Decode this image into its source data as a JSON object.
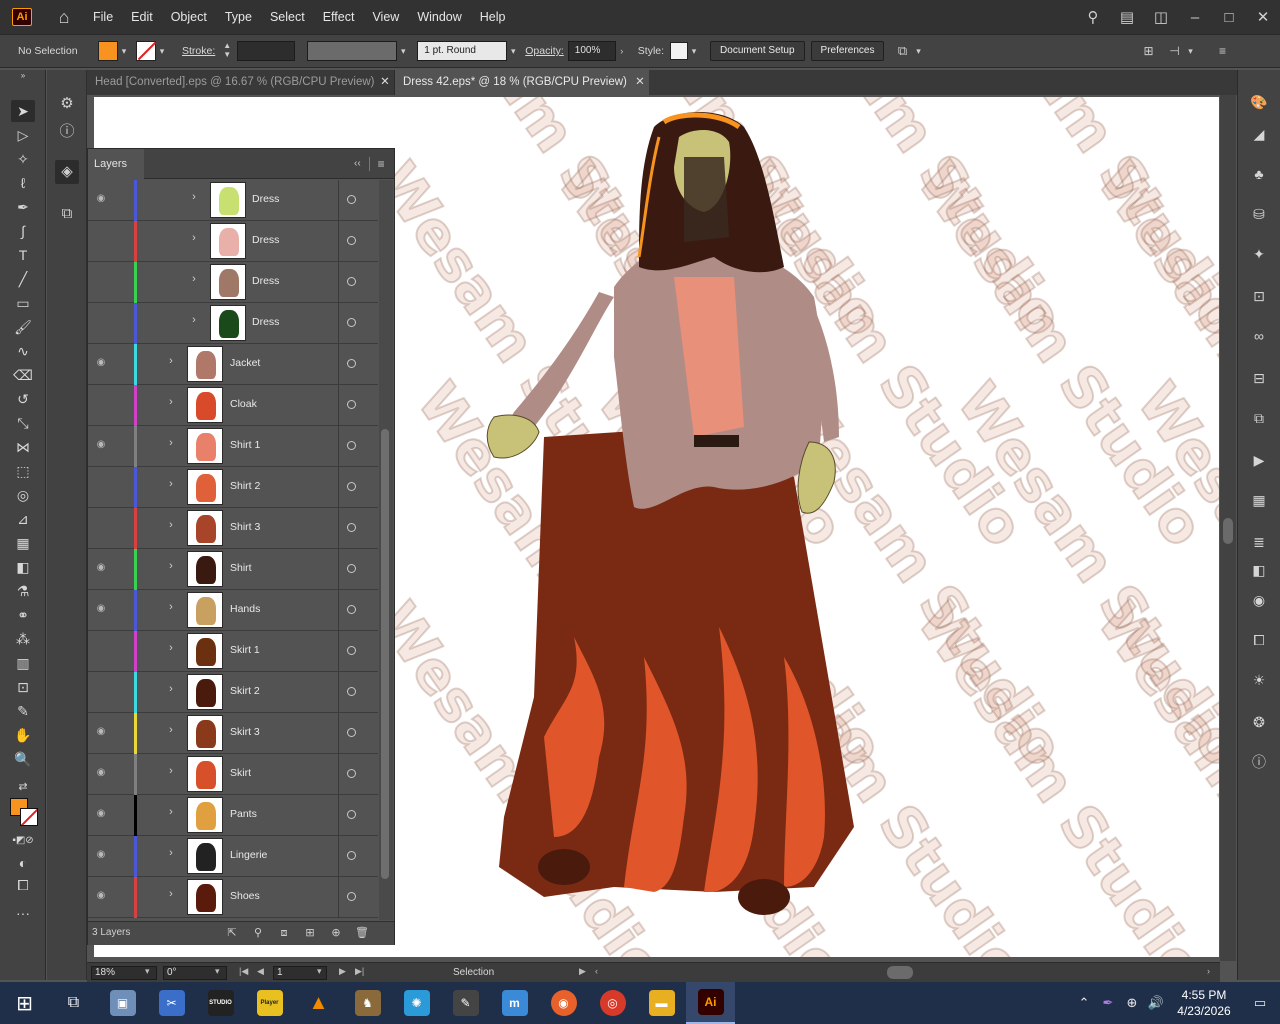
{
  "app": {
    "logo": "Ai",
    "home_icon": "home-icon"
  },
  "menu": [
    "File",
    "Edit",
    "Object",
    "Type",
    "Select",
    "Effect",
    "View",
    "Window",
    "Help"
  ],
  "control": {
    "selection_label": "No Selection",
    "fill_color": "#f7931e",
    "stroke_label": "Stroke:",
    "stroke_profile": "1 pt. Round",
    "opacity_label": "Opacity:",
    "opacity_value": "100%",
    "style_label": "Style:",
    "document_setup": "Document Setup",
    "preferences": "Preferences"
  },
  "tabs": [
    {
      "label": "Head [Converted].eps @ 16.67 % (RGB/CPU Preview)",
      "active": false
    },
    {
      "label": "Dress 42.eps* @ 18 % (RGB/CPU Preview)",
      "active": true
    }
  ],
  "layers": {
    "title": "Layers",
    "count_label": "3 Layers",
    "rows": [
      {
        "name": "Dress",
        "visible": true,
        "color": "#4a57d6",
        "sub": true
      },
      {
        "name": "Dress",
        "visible": false,
        "color": "#d94040",
        "sub": true
      },
      {
        "name": "Dress",
        "visible": false,
        "color": "#3ad052",
        "sub": true
      },
      {
        "name": "Dress",
        "visible": false,
        "color": "#4a57d6",
        "sub": true
      },
      {
        "name": "Jacket",
        "visible": true,
        "color": "#3fd7e0",
        "sub": false
      },
      {
        "name": "Cloak",
        "visible": false,
        "color": "#d040c8",
        "sub": false
      },
      {
        "name": "Shirt 1",
        "visible": true,
        "color": "#808080",
        "sub": false
      },
      {
        "name": "Shirt 2",
        "visible": false,
        "color": "#4a57d6",
        "sub": false
      },
      {
        "name": "Shirt 3",
        "visible": false,
        "color": "#d94040",
        "sub": false
      },
      {
        "name": "Shirt",
        "visible": true,
        "color": "#3ad052",
        "sub": false
      },
      {
        "name": "Hands",
        "visible": true,
        "color": "#4a57d6",
        "sub": false
      },
      {
        "name": "Skirt 1",
        "visible": false,
        "color": "#d040c8",
        "sub": false
      },
      {
        "name": "Skirt 2",
        "visible": false,
        "color": "#3fd7e0",
        "sub": false
      },
      {
        "name": "Skirt 3",
        "visible": true,
        "color": "#e8d83a",
        "sub": false
      },
      {
        "name": "Skirt",
        "visible": true,
        "color": "#808080",
        "sub": false
      },
      {
        "name": "Pants",
        "visible": true,
        "color": "#000000",
        "sub": false
      },
      {
        "name": "Lingerie",
        "visible": true,
        "color": "#4a57d6",
        "sub": false
      },
      {
        "name": "Shoes",
        "visible": true,
        "color": "#d94040",
        "sub": false
      }
    ]
  },
  "watermark": "Wesam Studio",
  "status": {
    "zoom": "18%",
    "rotation": "0°",
    "artboard": "1",
    "tool": "Selection"
  },
  "taskbar": {
    "time": "4:55 PM",
    "date": "4/23/2026",
    "studio_label": "STUDIO",
    "player_label": "Player"
  }
}
